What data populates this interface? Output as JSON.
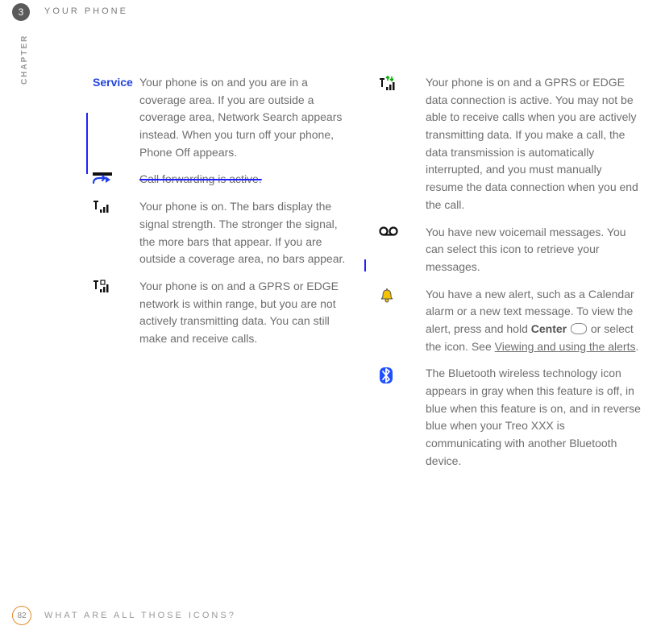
{
  "header": {
    "chapter_number": "3",
    "chapter_title": "YOUR PHONE",
    "side_label": "CHAPTER"
  },
  "footer": {
    "page_number": "82",
    "section_title": "WHAT ARE ALL THOSE ICONS?"
  },
  "left": {
    "service_label": "Service",
    "service_text": "Your phone is on and you are in a coverage area. If you are outside a coverage area, Network Search appears instead. When you turn off your phone, Phone Off appears.",
    "callfwd_text": "Call forwarding is active.",
    "signal_text": "Your phone is on. The bars display the signal strength. The stronger the signal, the more bars that appear. If you are outside a coverage area, no bars appear.",
    "gprs_range_text": "Your phone is on and a GPRS or EDGE network is within range, but you are not actively transmitting data. You can still make and receive calls."
  },
  "right": {
    "gprs_active_text": "Your phone is on and a GPRS or EDGE data connection is active. You may not be able to receive calls when you are actively transmitting data. If you make a call, the data transmission is automatically interrupted, and you must manually resume the data connection when you end the call.",
    "voicemail_text": "You have new voicemail messages. You can select this icon to retrieve your messages.",
    "alert_pre": "You have a new alert, such as a Calendar alarm or a new text message. To view the alert, press and hold ",
    "alert_center": "Center",
    "alert_mid": " or select the icon. See ",
    "alert_link": "Viewing and using the alerts",
    "alert_post": ".",
    "bluetooth_text": "The Bluetooth wireless technology icon appears in gray when this feature is off, in blue when this feature is on, and in reverse blue when your Treo XXX is communicating with another Bluetooth device."
  }
}
